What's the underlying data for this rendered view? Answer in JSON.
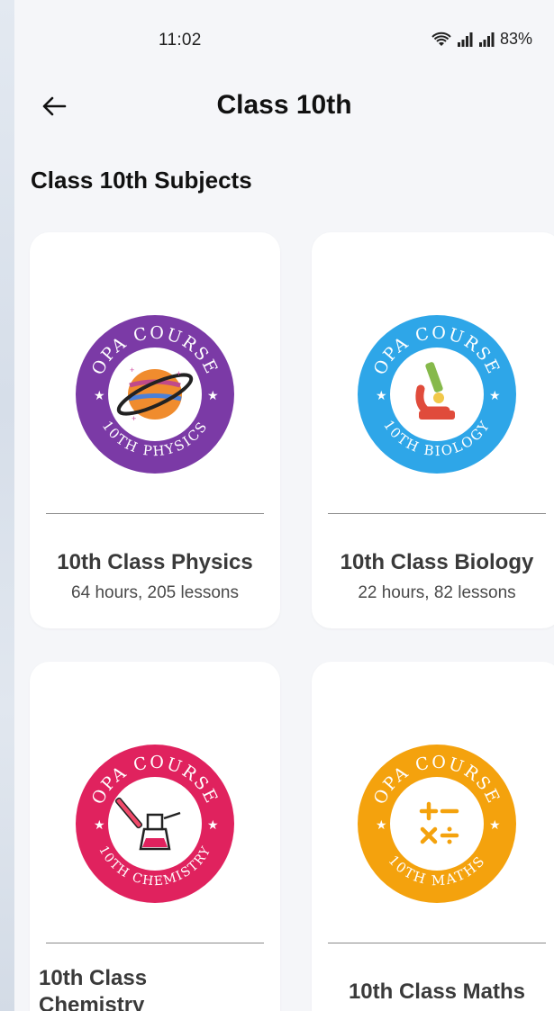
{
  "status_bar": {
    "time": "11:02",
    "battery": "83%"
  },
  "header": {
    "title": "Class 10th"
  },
  "section": {
    "title": "Class 10th Subjects"
  },
  "courses": [
    {
      "title": "10th Class Physics",
      "subtitle": "64 hours, 205 lessons",
      "badge_top": "OPA COURSE",
      "badge_bottom": "10TH PHYSICS",
      "color": "#7b3aa6"
    },
    {
      "title": "10th Class Biology",
      "subtitle": "22 hours, 82 lessons",
      "badge_top": "OPA COURSE",
      "badge_bottom": "10TH BIOLOGY",
      "color": "#2ea6e8"
    },
    {
      "title": "10th Class Chemistry",
      "subtitle": "",
      "badge_top": "OPA COURSE",
      "badge_bottom": "10TH CHEMISTRY",
      "color": "#e0225e"
    },
    {
      "title": "10th Class Maths",
      "subtitle": "",
      "badge_top": "OPA COURSE",
      "badge_bottom": "10TH MATHS",
      "color": "#f4a20d"
    }
  ]
}
